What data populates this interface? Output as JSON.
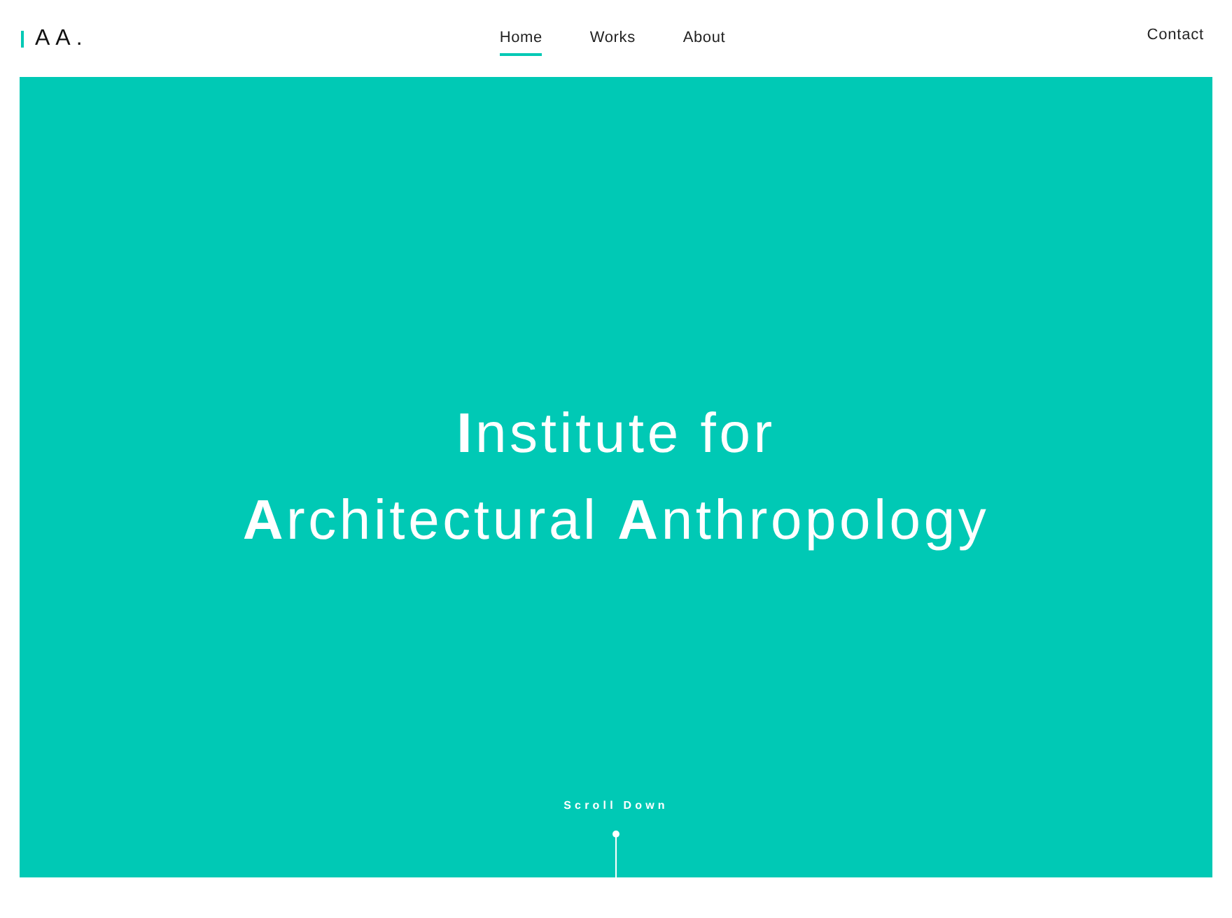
{
  "logo": {
    "text": "AA."
  },
  "nav": {
    "items": [
      {
        "label": "Home",
        "selected": true
      },
      {
        "label": "Works",
        "selected": false
      },
      {
        "label": "About",
        "selected": false
      }
    ],
    "contact": "Contact"
  },
  "hero": {
    "title_lines": [
      "**I**nstitute for",
      "**A**rchitectural **A**nthropology"
    ],
    "scroll_label": "Scroll Down"
  }
}
